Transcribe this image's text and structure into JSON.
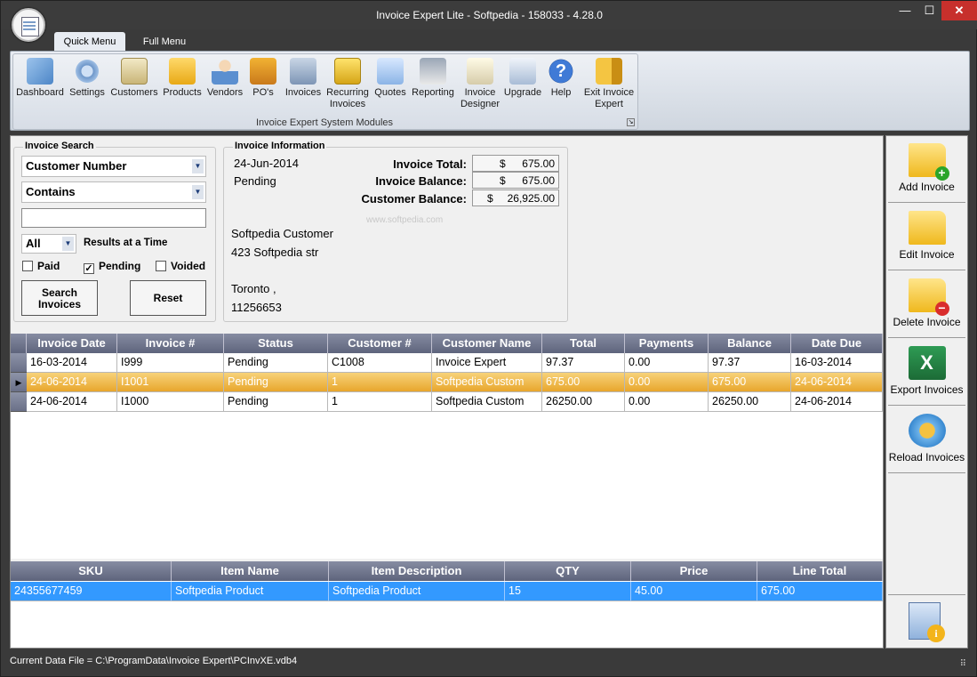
{
  "window": {
    "title": "Invoice Expert Lite - Softpedia - 158033 - 4.28.0",
    "minimize": "—",
    "maximize": "☐",
    "close": "✕"
  },
  "tabs": {
    "quick": "Quick Menu",
    "full": "Full Menu"
  },
  "ribbon": {
    "caption": "Invoice Expert System Modules",
    "modules": [
      {
        "label": "Dashboard",
        "icon": "dashboard-icon"
      },
      {
        "label": "Settings",
        "icon": "settings-icon"
      },
      {
        "label": "Customers",
        "icon": "customers-icon"
      },
      {
        "label": "Products",
        "icon": "products-icon"
      },
      {
        "label": "Vendors",
        "icon": "vendors-icon"
      },
      {
        "label": "PO's",
        "icon": "purchase-orders-icon"
      },
      {
        "label": "Invoices",
        "icon": "invoices-icon"
      },
      {
        "label": "Recurring Invoices",
        "icon": "recurring-invoices-icon"
      },
      {
        "label": "Quotes",
        "icon": "quotes-icon"
      },
      {
        "label": "Reporting",
        "icon": "reporting-icon"
      },
      {
        "label": "Invoice Designer",
        "icon": "invoice-designer-icon"
      },
      {
        "label": "Upgrade",
        "icon": "upgrade-icon"
      },
      {
        "label": "Help",
        "icon": "help-icon"
      },
      {
        "label": "Exit Invoice Expert",
        "icon": "exit-icon"
      }
    ]
  },
  "search": {
    "title": "Invoice Search",
    "field": "Customer Number",
    "operator": "Contains",
    "value": "",
    "results_count": "All",
    "results_label": "Results at a Time",
    "paid": {
      "label": "Paid",
      "checked": false
    },
    "pending": {
      "label": "Pending",
      "checked": true
    },
    "voided": {
      "label": "Voided",
      "checked": false
    },
    "search_button": "Search Invoices",
    "reset_button": "Reset"
  },
  "info": {
    "title": "Invoice Information",
    "date": "24-Jun-2014",
    "status": "Pending",
    "total_label": "Invoice Total:",
    "balance_label": "Invoice Balance:",
    "customer_balance_label": "Customer Balance:",
    "currency": "$",
    "total": "675.00",
    "balance": "675.00",
    "customer_balance": "26,925.00",
    "customer_name": "Softpedia Customer",
    "address1": "423 Softpedia str",
    "city": "Toronto ,",
    "zip": "11256653",
    "watermark": "www.softpedia.com"
  },
  "invoices": {
    "columns": [
      "Invoice Date",
      "Invoice #",
      "Status",
      "Customer #",
      "Customer Name",
      "Total",
      "Payments",
      "Balance",
      "Date Due"
    ],
    "rows": [
      [
        "16-03-2014",
        "I999",
        "Pending",
        "C1008",
        "Invoice Expert",
        "97.37",
        "0.00",
        "97.37",
        "16-03-2014"
      ],
      [
        "24-06-2014",
        "I1001",
        "Pending",
        "1",
        "Softpedia Custom",
        "675.00",
        "0.00",
        "675.00",
        "24-06-2014"
      ],
      [
        "24-06-2014",
        "I1000",
        "Pending",
        "1",
        "Softpedia Custom",
        "26250.00",
        "0.00",
        "26250.00",
        "24-06-2014"
      ]
    ],
    "current_row_marker": "▶"
  },
  "items": {
    "columns": [
      "SKU",
      "Item Name",
      "Item Description",
      "QTY",
      "Price",
      "Line Total"
    ],
    "rows": [
      [
        "24355677459",
        "Softpedia Product",
        "Softpedia Product",
        "15",
        "45.00",
        "675.00"
      ]
    ]
  },
  "actions": {
    "add": "Add Invoice",
    "edit": "Edit Invoice",
    "delete": "Delete Invoice",
    "export": "Export Invoices",
    "reload": "Reload Invoices"
  },
  "status_bar": "Current Data File = C:\\ProgramData\\Invoice Expert\\PCInvXE.vdb4"
}
